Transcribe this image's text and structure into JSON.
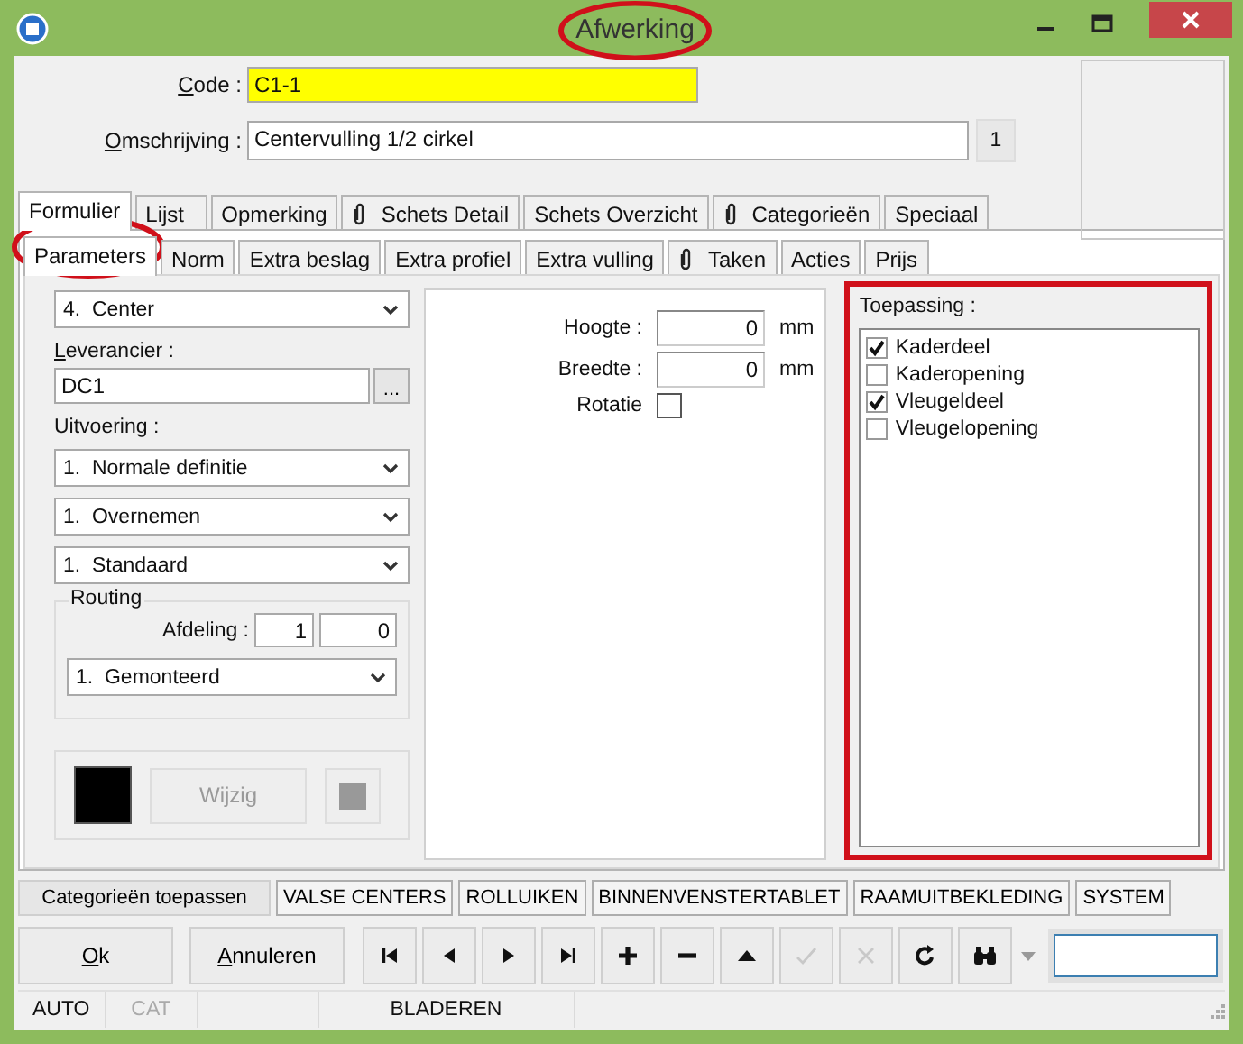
{
  "window": {
    "title": "Afwerking",
    "title_circled": true
  },
  "code": {
    "label": "Code :",
    "mnemonic": true,
    "value": "C1-1"
  },
  "omschrijving": {
    "label": "Omschrijving :",
    "mnemonic": true,
    "value": "Centervulling 1/2 cirkel",
    "counter": "1"
  },
  "tabs": [
    {
      "label": "Formulier",
      "selected": true,
      "attachment": false
    },
    {
      "label": "Lijst",
      "selected": false,
      "attachment": false
    },
    {
      "label": "Opmerking",
      "selected": false,
      "attachment": false
    },
    {
      "label": "Schets Detail",
      "selected": false,
      "attachment": true
    },
    {
      "label": "Schets Overzicht",
      "selected": false,
      "attachment": false
    },
    {
      "label": "Categorieën",
      "selected": false,
      "attachment": true
    },
    {
      "label": "Speciaal",
      "selected": false,
      "attachment": false
    }
  ],
  "subtabs": [
    {
      "label": "Parameters",
      "selected": true,
      "attachment": false,
      "circled": true
    },
    {
      "label": "Norm",
      "selected": false,
      "attachment": false,
      "circled": false
    },
    {
      "label": "Extra beslag",
      "selected": false,
      "attachment": false,
      "circled": false
    },
    {
      "label": "Extra profiel",
      "selected": false,
      "attachment": false,
      "circled": false
    },
    {
      "label": "Extra vulling",
      "selected": false,
      "attachment": false,
      "circled": false
    },
    {
      "label": "Taken",
      "selected": false,
      "attachment": true,
      "circled": false
    },
    {
      "label": "Acties",
      "selected": false,
      "attachment": false,
      "circled": false
    },
    {
      "label": "Prijs",
      "selected": false,
      "attachment": false,
      "circled": false
    }
  ],
  "parameters": {
    "type_select": "4.  Center",
    "leverancier": {
      "label": "Leverancier :",
      "mnemonic": true,
      "value": "DC1",
      "browse": "..."
    },
    "uitvoering": {
      "label": "Uitvoering :",
      "selects": [
        "1.  Normale definitie",
        "1.  Overnemen",
        "1.  Standaard"
      ]
    },
    "routing": {
      "title": "Routing",
      "afdeling_label": "Afdeling :",
      "afdeling_values": [
        "1",
        "0"
      ],
      "select": "1.  Gemonteerd"
    },
    "color": {
      "button": "Wijzig",
      "button_disabled": true
    }
  },
  "dimensions": {
    "fields": [
      {
        "label": "Hoogte :",
        "value": "0",
        "unit": "mm"
      },
      {
        "label": "Breedte :",
        "value": "0",
        "unit": "mm"
      }
    ],
    "rotatie": {
      "label": "Rotatie",
      "checked": false
    }
  },
  "toepassing": {
    "label": "Toepassing :",
    "outlined": true,
    "items": [
      {
        "label": "Kaderdeel",
        "checked": true
      },
      {
        "label": "Kaderopening",
        "checked": false
      },
      {
        "label": "Vleugeldeel",
        "checked": true
      },
      {
        "label": "Vleugelopening",
        "checked": false
      }
    ]
  },
  "category_buttons": [
    "Categorieën toepassen",
    "VALSE CENTERS",
    "ROLLUIKEN",
    "BINNENVENSTERTABLET",
    "RAAMUITBEKLEDING",
    "SYSTEM"
  ],
  "actions": [
    {
      "label": "Ok",
      "mnemonic": true
    },
    {
      "label": "Annuleren",
      "mnemonic": true
    }
  ],
  "nav_buttons": [
    {
      "kind": "first",
      "disabled": false
    },
    {
      "kind": "prev",
      "disabled": false
    },
    {
      "kind": "next",
      "disabled": false
    },
    {
      "kind": "last",
      "disabled": false
    },
    {
      "kind": "add",
      "disabled": false
    },
    {
      "kind": "remove",
      "disabled": false
    },
    {
      "kind": "up",
      "disabled": false
    },
    {
      "kind": "confirm",
      "disabled": true
    },
    {
      "kind": "cancel",
      "disabled": true
    },
    {
      "kind": "refresh",
      "disabled": false
    },
    {
      "kind": "find",
      "disabled": false
    }
  ],
  "status_bar": [
    {
      "text": "AUTO",
      "kind": "flag",
      "disabled": false
    },
    {
      "text": "CAT",
      "kind": "flag",
      "disabled": true
    },
    {
      "text": "BLADEREN",
      "kind": "mode",
      "disabled": false
    }
  ]
}
